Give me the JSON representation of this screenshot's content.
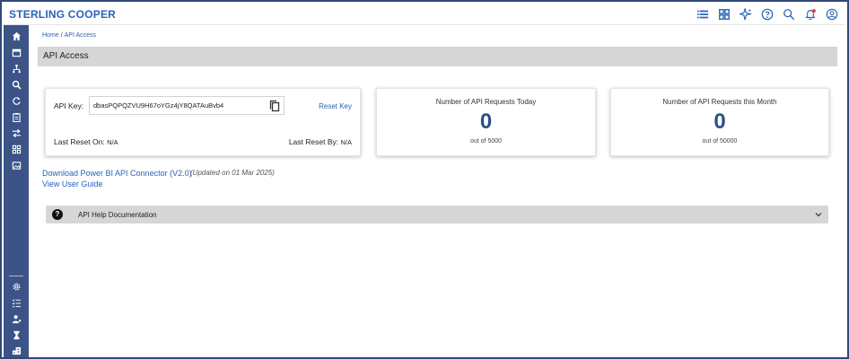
{
  "app": {
    "brand": "STERLING COOPER"
  },
  "topbar": {
    "icons": [
      "list-icon",
      "grid-icon",
      "sparkle-icon",
      "help-icon",
      "search-icon",
      "notification-icon",
      "account-icon"
    ]
  },
  "sidebar": {
    "top_items": [
      "home-icon",
      "calendar-icon",
      "hierarchy-icon",
      "search-icon",
      "refresh-icon",
      "clipboard-icon",
      "transfer-icon",
      "apps-icon",
      "gallery-icon"
    ],
    "bottom_items": [
      "settings-icon",
      "checklist-icon",
      "user-admin-icon",
      "hourglass-icon",
      "building-icon"
    ]
  },
  "breadcrumb": {
    "home": "Home",
    "separator": "/",
    "current": "API Access"
  },
  "page": {
    "title": "API Access"
  },
  "api_key_card": {
    "key_label": "API Key:",
    "key_value": "dbasPQPQZVU9H67oYGz4jY8QATAuBvb4",
    "reset_label": "Reset Key",
    "last_reset_on_label": "Last Reset On:",
    "last_reset_on_value": "N/A",
    "last_reset_by_label": "Last Reset By:",
    "last_reset_by_value": "N/A"
  },
  "stats": {
    "today": {
      "title": "Number of API Requests Today",
      "value": "0",
      "sub": "out of 5000"
    },
    "month": {
      "title": "Number of API Requests this Month",
      "value": "0",
      "sub": "out of 50000"
    }
  },
  "links": {
    "download": "Download Power BI API Connector (V2.0)",
    "download_note": "(Updated on 01 Mar 2025)",
    "guide": "View User Guide"
  },
  "help": {
    "icon_glyph": "?",
    "title": "API Help Documentation"
  },
  "colors": {
    "sidebar": "#3b5386",
    "link": "#2a63b8",
    "stat": "#2b4f86",
    "header_bar": "#d6d6d6"
  }
}
